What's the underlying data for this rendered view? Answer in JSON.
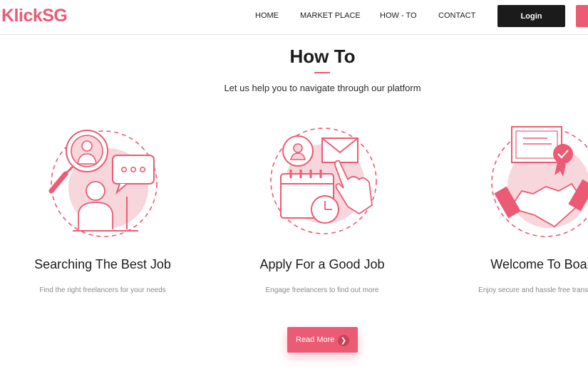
{
  "header": {
    "logo": "KlickSG",
    "nav": [
      "HOME",
      "MARKET PLACE",
      "HOW - TO",
      "CONTACT"
    ],
    "login_label": "Login"
  },
  "section": {
    "title": "How To",
    "subtitle": "Let us help you to navigate through our platform"
  },
  "cards": [
    {
      "title": "Searching The Best Job",
      "description": "Find the right freelancers for your needs",
      "icon": "search-job-illustration"
    },
    {
      "title": "Apply For a Good Job",
      "description": "Engage freelancers to find out more",
      "icon": "apply-job-illustration"
    },
    {
      "title": "Welcome To Board",
      "description": "Enjoy secure and hassle free transactions",
      "icon": "handshake-illustration"
    }
  ],
  "cta": {
    "label": "Read More",
    "icon": "chevron-right-icon"
  },
  "colors": {
    "accent": "#ec5b74",
    "dark": "#1b1b1b",
    "illustration_fill": "#f7d6dc"
  }
}
